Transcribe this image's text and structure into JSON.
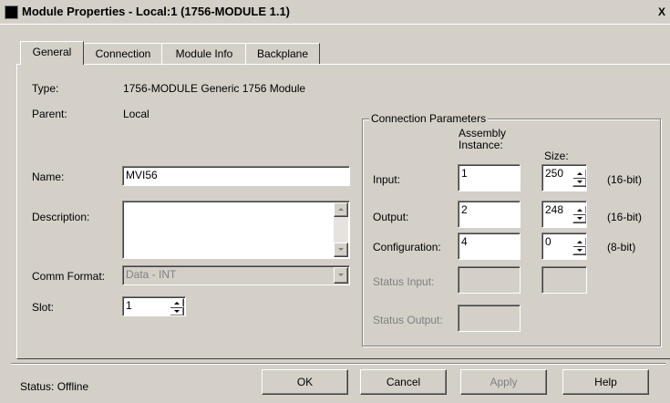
{
  "window": {
    "title": "Module Properties  - Local:1 (1756-MODULE 1.1)",
    "close_glyph": "X"
  },
  "tabs": [
    {
      "label": "General",
      "active": true
    },
    {
      "label": "Connection",
      "active": false
    },
    {
      "label": "Module Info",
      "active": false
    },
    {
      "label": "Backplane",
      "active": false
    }
  ],
  "general": {
    "type_label": "Type:",
    "type_value": "1756-MODULE Generic 1756 Module",
    "parent_label": "Parent:",
    "parent_value": "Local",
    "name_label": "Name:",
    "name_value": "MVI56",
    "description_label": "Description:",
    "description_value": "",
    "comm_format_label": "Comm Format:",
    "comm_format_value": "Data - INT",
    "slot_label": "Slot:",
    "slot_value": "1"
  },
  "connection_parameters": {
    "title": "Connection Parameters",
    "assembly_header_line1": "Assembly",
    "assembly_header_line2": "Instance:",
    "size_header": "Size:",
    "rows": [
      {
        "label": "Input:",
        "instance": "1",
        "size": "250",
        "unit": "(16-bit)",
        "enabled": true
      },
      {
        "label": "Output:",
        "instance": "2",
        "size": "248",
        "unit": "(16-bit)",
        "enabled": true
      },
      {
        "label": "Configuration:",
        "instance": "4",
        "size": "0",
        "unit": "(8-bit)",
        "enabled": true
      },
      {
        "label": "Status Input:",
        "instance": "",
        "size": "",
        "unit": "",
        "enabled": false
      },
      {
        "label": "Status Output:",
        "instance": "",
        "size": "",
        "unit": "",
        "enabled": false
      }
    ]
  },
  "footer": {
    "status": "Status:  Offline",
    "ok": "OK",
    "cancel": "Cancel",
    "apply": "Apply",
    "help": "Help"
  },
  "colors": {
    "dialog_bg": "#d4d0c8",
    "field_bg": "#ffffff",
    "disabled_text": "#808080"
  }
}
